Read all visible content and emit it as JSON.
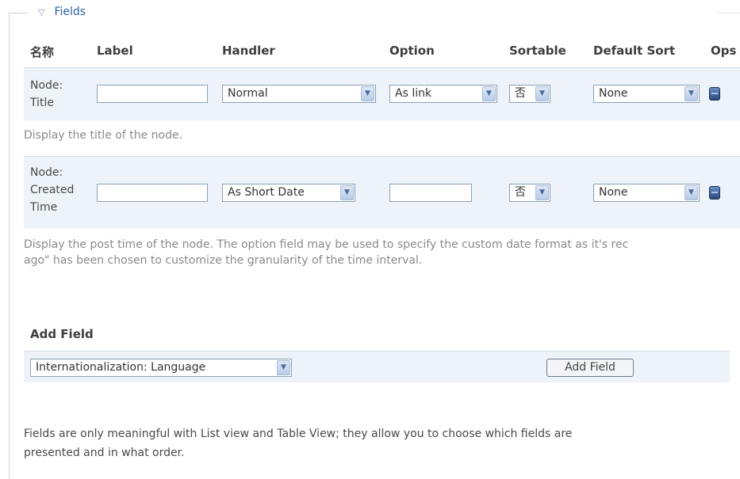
{
  "fieldset": {
    "legend": "Fields",
    "toggle_icon": "collapse-triangle-icon"
  },
  "table": {
    "headers": [
      "名称",
      "Label",
      "Handler",
      "Option",
      "Sortable",
      "Default Sort",
      "Ops"
    ],
    "rows": [
      {
        "name_lines": [
          "Node:",
          "Title"
        ],
        "label_value": "",
        "handler": "Normal",
        "option_select": "As link",
        "option_text": "",
        "sortable": "否",
        "default_sort": "None",
        "ops_icon": "ops-edit-icon",
        "description": "Display the title of the node."
      },
      {
        "name_lines": [
          "Node:",
          "Created",
          "Time"
        ],
        "label_value": "",
        "handler": "As Short Date",
        "option_select": "",
        "option_text": "",
        "sortable": "否",
        "default_sort": "None",
        "ops_icon": "ops-edit-icon",
        "description_lines": [
          "Display the post time of the node. The option field may be used to specify the custom date format as it's rec",
          "ago\" has been chosen to customize the granularity of the time interval."
        ]
      }
    ]
  },
  "add_field": {
    "title": "Add Field",
    "select_value": "Internationalization: Language",
    "button_label": "Add Field"
  },
  "help_text_lines": [
    "Fields are only meaningful with List view and Table View; they allow you to choose which fields are",
    "presented and in what order."
  ],
  "colors": {
    "link": "#2a64a0",
    "row_bg": "#edf3f9",
    "muted_text": "#8a8a8a"
  }
}
